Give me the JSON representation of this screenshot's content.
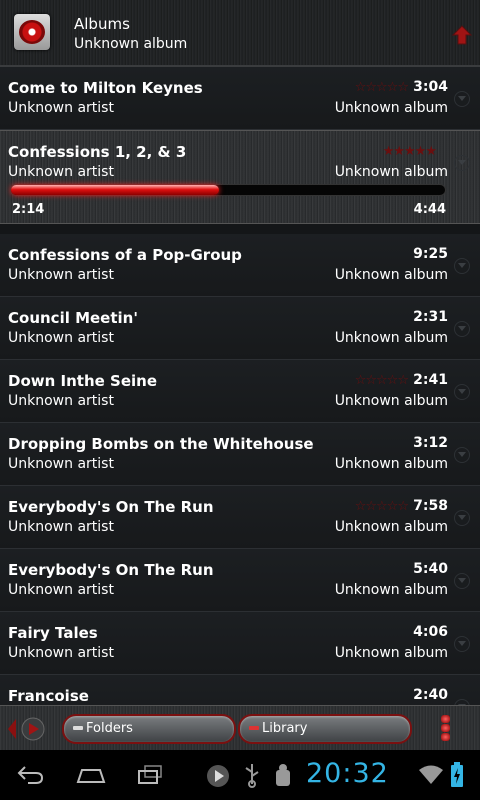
{
  "header": {
    "title": "Albums",
    "subtitle": "Unknown album",
    "up_icon": "up-arrow-icon"
  },
  "tracks": [
    {
      "title": "Come to Milton Keynes",
      "artist": "Unknown artist",
      "album": "Unknown album",
      "duration": "3:04",
      "stars": "☆☆☆☆☆"
    },
    {
      "title": "Confessions 1, 2, & 3",
      "artist": "Unknown artist",
      "album": "Unknown album",
      "duration": "",
      "stars": "★★★★★",
      "playing": true
    },
    {
      "title": "Confessions of a Pop-Group",
      "artist": "Unknown artist",
      "album": "Unknown album",
      "duration": "9:25",
      "stars": ""
    },
    {
      "title": "Council Meetin'",
      "artist": "Unknown artist",
      "album": "Unknown album",
      "duration": "2:31",
      "stars": ""
    },
    {
      "title": "Down Inthe Seine",
      "artist": "Unknown artist",
      "album": "Unknown album",
      "duration": "2:41",
      "stars": "☆☆☆☆☆"
    },
    {
      "title": "Dropping Bombs on the Whitehouse",
      "artist": "Unknown artist",
      "album": "Unknown album",
      "duration": "3:12",
      "stars": ""
    },
    {
      "title": "Everybody's On The Run",
      "artist": "Unknown artist",
      "album": "Unknown album",
      "duration": "7:58",
      "stars": "☆☆☆☆☆"
    },
    {
      "title": "Everybody's On The Run",
      "artist": "Unknown artist",
      "album": "Unknown album",
      "duration": "5:40",
      "stars": ""
    },
    {
      "title": "Fairy Tales",
      "artist": "Unknown artist",
      "album": "Unknown album",
      "duration": "4:06",
      "stars": ""
    },
    {
      "title": "Francoise",
      "artist": "Unknown artist",
      "album": "Unknown album",
      "duration": "2:40",
      "stars": ""
    }
  ],
  "now_playing": {
    "elapsed": "2:14",
    "total": "4:44",
    "progress_fraction": 0.48
  },
  "bottom_bar": {
    "folders_label": "Folders",
    "library_label": "Library"
  },
  "system_bar": {
    "clock": "20:32"
  },
  "colors": {
    "accent_red": "#e01010",
    "clock_blue": "#34b5e5"
  }
}
